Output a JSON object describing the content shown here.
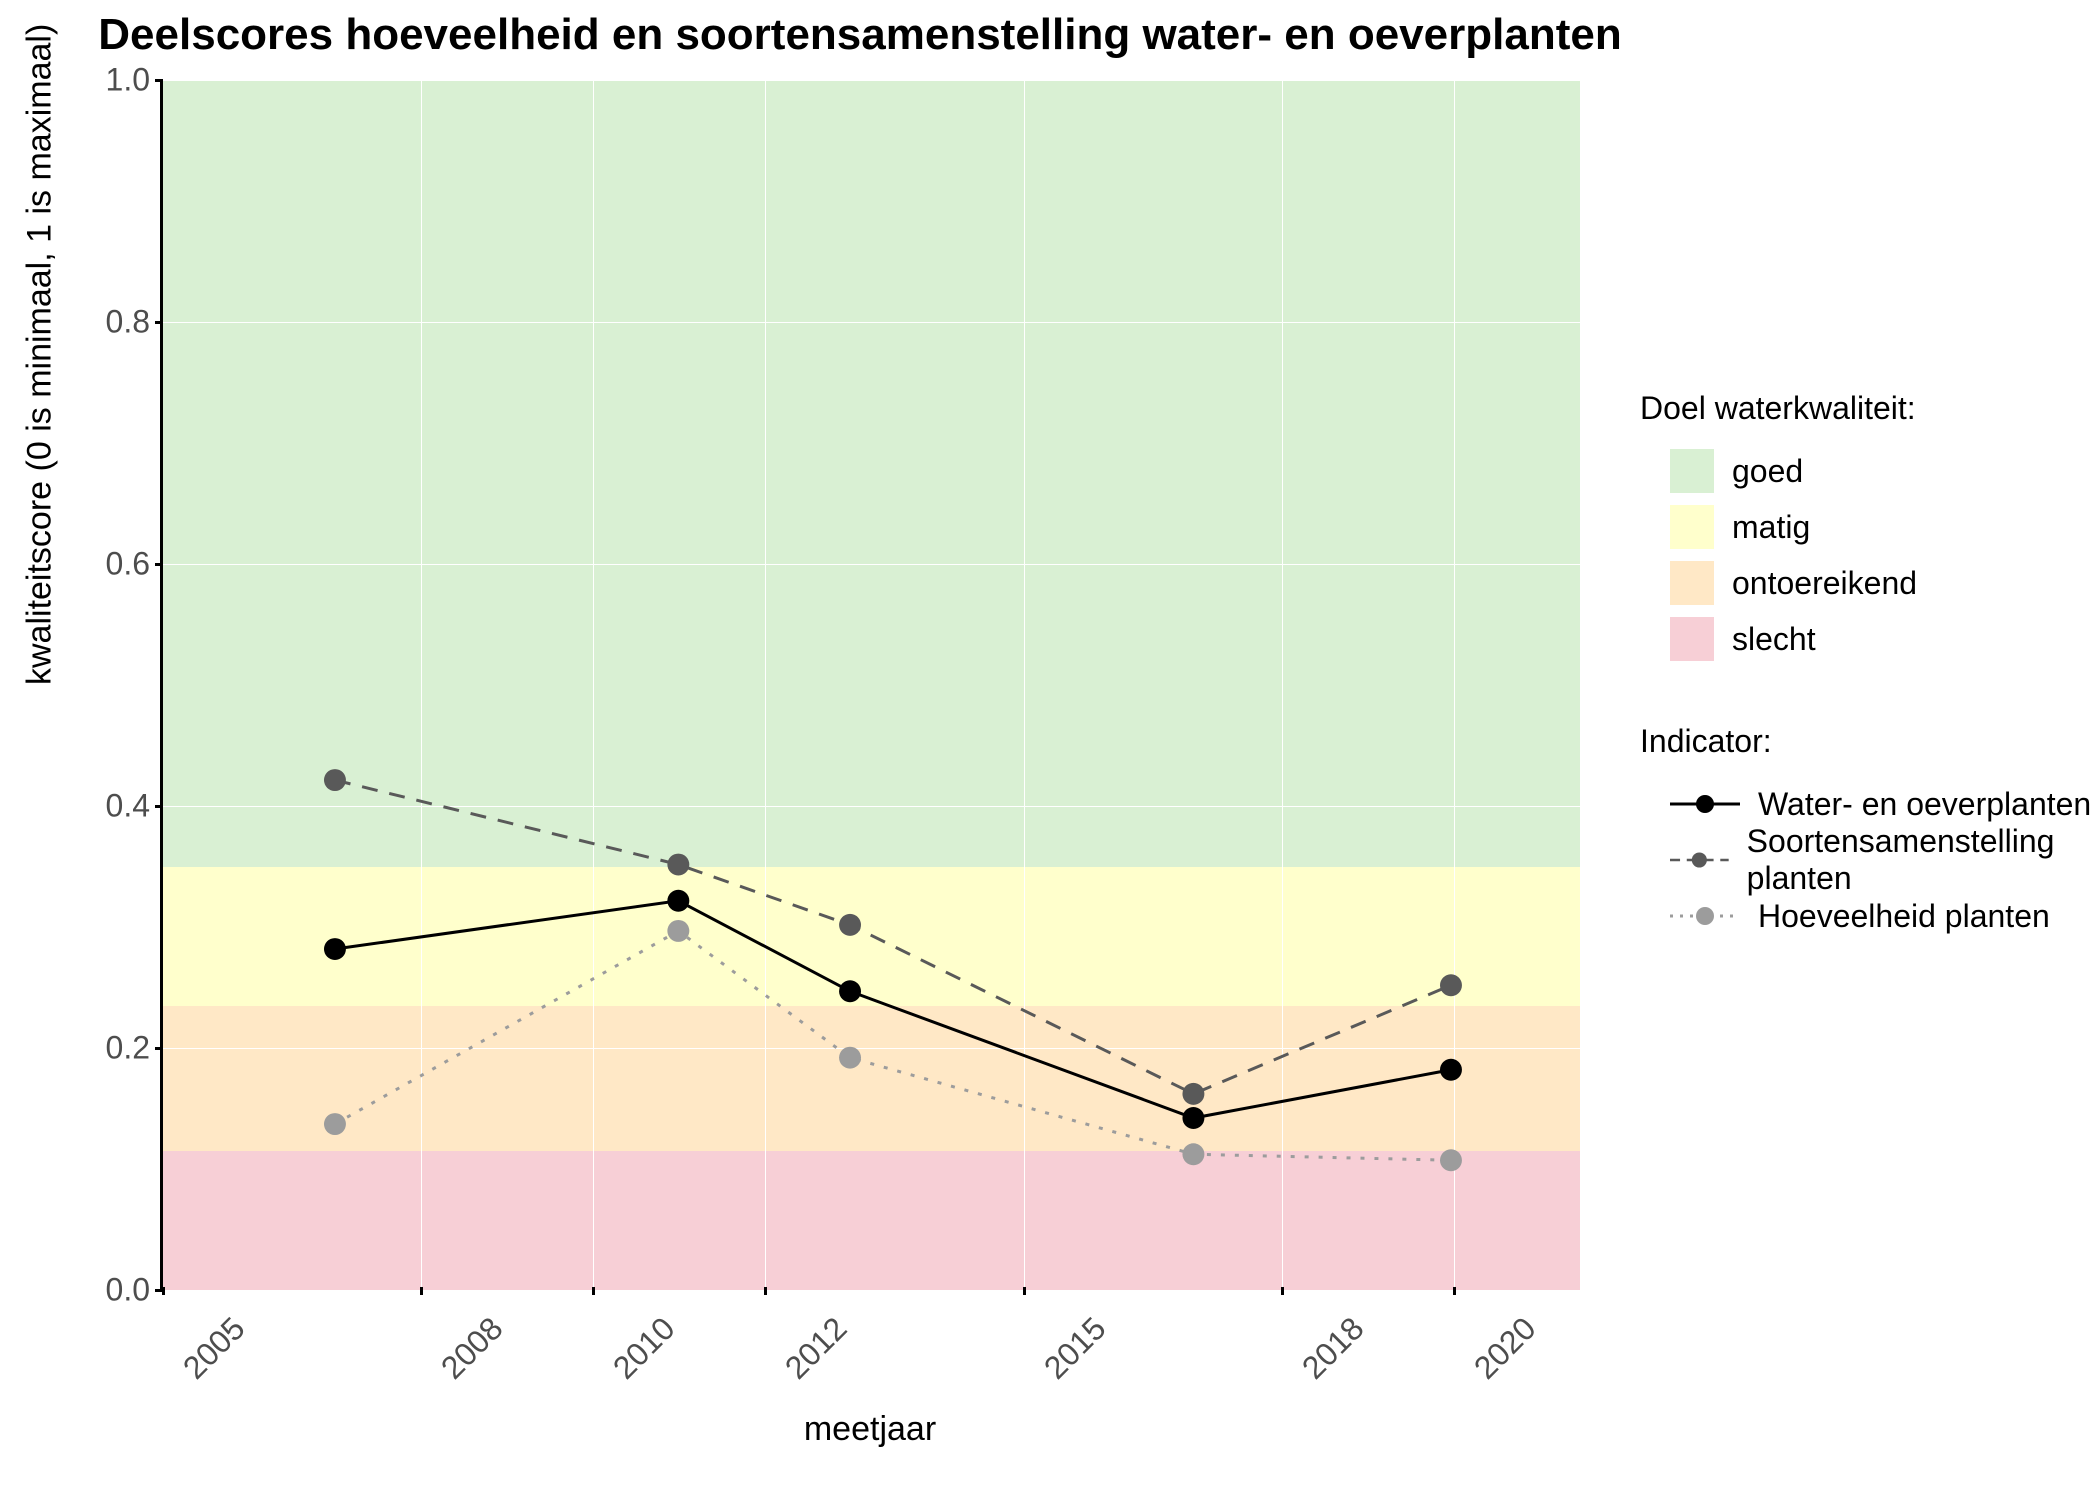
{
  "chart_data": {
    "type": "line",
    "title": "Deelscores hoeveelheid en soortensamenstelling water- en oeverplanten",
    "xlabel": "meetjaar",
    "ylabel": "kwaliteitscore (0 is minimaal, 1 is maximaal)",
    "x": [
      2007,
      2011,
      2013,
      2017,
      2020
    ],
    "series": [
      {
        "name": "Water- en oeverplanten",
        "color": "#000000",
        "dash": "solid",
        "values": [
          0.28,
          0.32,
          0.245,
          0.14,
          0.18
        ]
      },
      {
        "name": "Soortensamenstelling planten",
        "color": "#595959",
        "dash": "dashed",
        "values": [
          0.42,
          0.35,
          0.3,
          0.16,
          0.25
        ]
      },
      {
        "name": "Hoeveelheid planten",
        "color": "#9c9c9c",
        "dash": "dotted",
        "values": [
          0.135,
          0.295,
          0.19,
          0.11,
          0.105
        ]
      }
    ],
    "xlim": [
      2005,
      2021.5
    ],
    "ylim": [
      0.0,
      1.0
    ],
    "x_ticks": [
      2005,
      2008,
      2010,
      2012,
      2015,
      2018,
      2020
    ],
    "x_tick_labels": [
      "2005",
      "2008",
      "2010",
      "2012",
      "2015",
      "2018",
      "2020"
    ],
    "y_ticks": [
      0.0,
      0.2,
      0.4,
      0.6,
      0.8,
      1.0
    ],
    "y_tick_labels": [
      "0.0",
      "0.2",
      "0.4",
      "0.6",
      "0.8",
      "1.0"
    ],
    "bands": [
      {
        "name": "goed",
        "from": 0.35,
        "to": 1.0,
        "color": "#d9f0d3"
      },
      {
        "name": "matig",
        "from": 0.235,
        "to": 0.35,
        "color": "#ffffcc"
      },
      {
        "name": "ontoereikend",
        "from": 0.115,
        "to": 0.235,
        "color": "#ffe8c6"
      },
      {
        "name": "slecht",
        "from": 0.0,
        "to": 0.115,
        "color": "#f7cfd6"
      }
    ],
    "legend_band_title": "Doel waterkwaliteit:",
    "legend_series_title": "Indicator:"
  }
}
